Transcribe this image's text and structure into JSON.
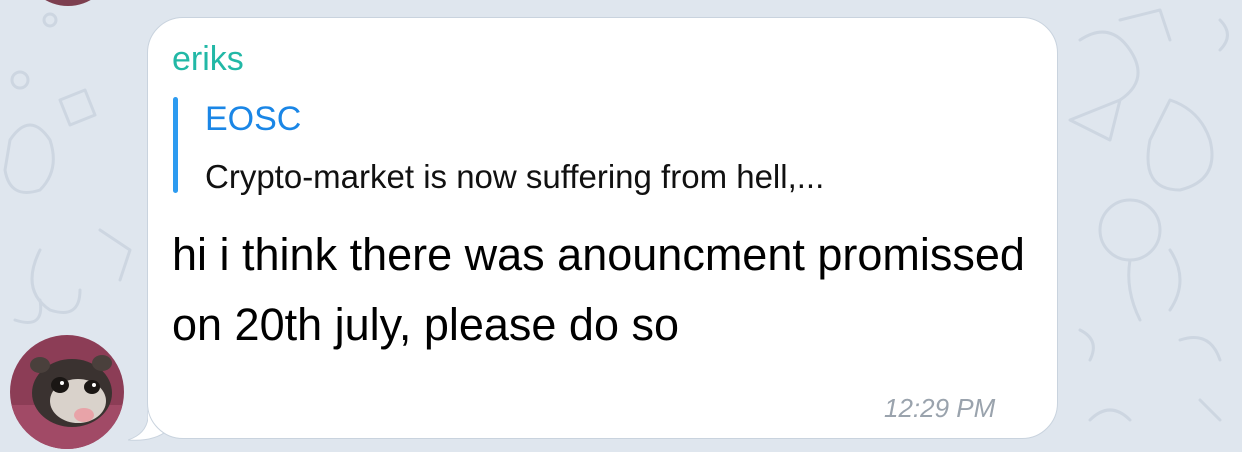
{
  "message": {
    "sender": "eriks",
    "reply": {
      "title": "EOSC",
      "snippet": "Crypto-market is now suffering from hell,..."
    },
    "text": "hi i think there was anouncment promissed on 20th july, please do so",
    "time": "12:29 PM"
  },
  "colors": {
    "sender": "#22b8a6",
    "reply_accent": "#2d9bf0",
    "reply_title": "#1a86e6",
    "time": "#9aa3ad",
    "wallpaper": "#dfe6ee"
  },
  "icons": {
    "avatar": "ferret-avatar",
    "top_avatar": "previous-avatar"
  }
}
